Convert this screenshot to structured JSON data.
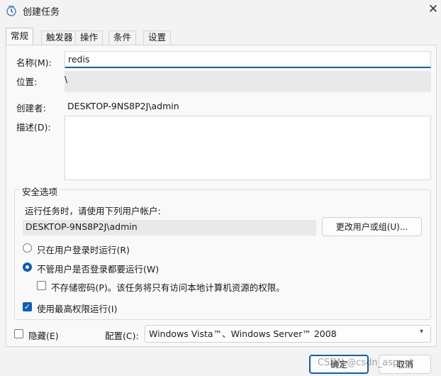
{
  "window": {
    "title": "创建任务",
    "icon": "task-scheduler-icon",
    "close_glyph": "✕"
  },
  "tabs": [
    {
      "label": "常规",
      "active": true
    },
    {
      "label": "触发器",
      "active": false
    },
    {
      "label": "操作",
      "active": false
    },
    {
      "label": "条件",
      "active": false
    },
    {
      "label": "设置",
      "active": false
    }
  ],
  "general": {
    "name_label": "名称(M):",
    "name_value": "redis",
    "location_label": "位置:",
    "location_value": "\\",
    "author_label": "创建者:",
    "author_value": "DESKTOP-9NS8P2J\\admin",
    "description_label": "描述(D):",
    "description_value": ""
  },
  "security": {
    "title": "安全选项",
    "run_as_label": "运行任务时，请使用下列用户帐户:",
    "user_account": "DESKTOP-9NS8P2J\\admin",
    "change_user_button": "更改用户或组(U)...",
    "radio_logged_on": "只在用户登录时运行(R)",
    "radio_logged_on_checked": false,
    "radio_whether": "不管用户是否登录都要运行(W)",
    "radio_whether_checked": true,
    "no_store_password": "不存储密码(P)。该任务将只有访问本地计算机资源的权限。",
    "no_store_password_checked": false,
    "highest_privileges": "使用最高权限运行(I)",
    "highest_privileges_checked": true
  },
  "footer": {
    "hidden_label": "隐藏(E)",
    "hidden_checked": false,
    "config_label": "配置(C):",
    "config_value": "Windows Vista™、Windows Server™ 2008",
    "ok_button": "确定",
    "cancel_button": "取消",
    "watermark": "CSDN @csdn_aspnet"
  },
  "colors": {
    "accent": "#0a5fb4",
    "window_bg": "#f3f3f3",
    "panel_bg": "#f9f9f9"
  }
}
